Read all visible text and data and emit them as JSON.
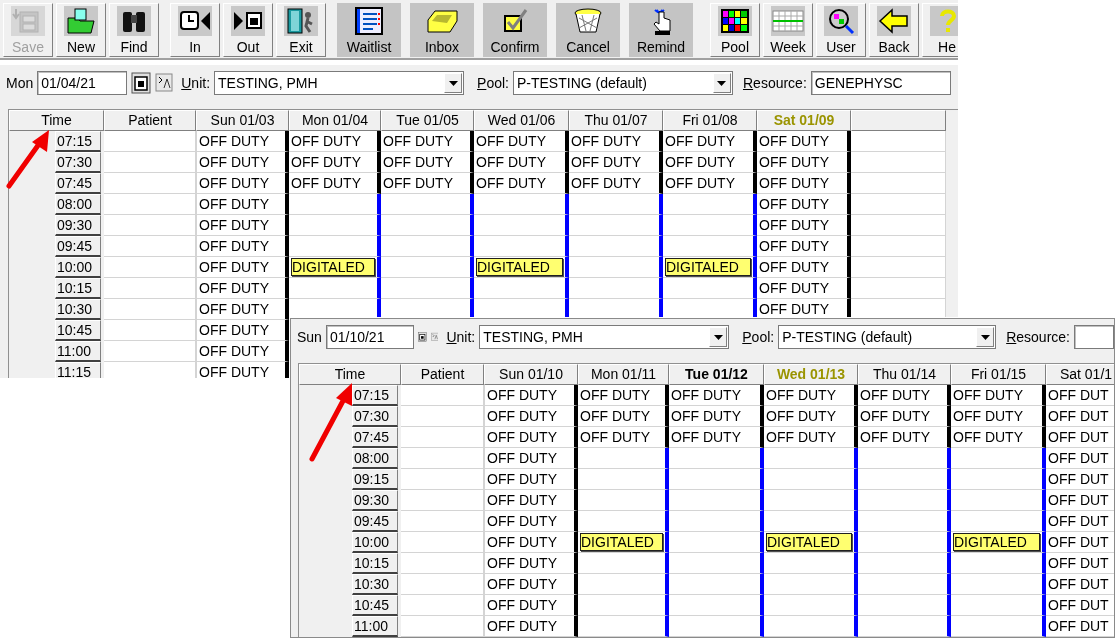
{
  "toolbar": {
    "groups": [
      {
        "kind": "raised",
        "buttons": [
          {
            "label": "Save",
            "disabled": true
          },
          {
            "label": "New",
            "disabled": false
          },
          {
            "label": "Find",
            "disabled": false
          }
        ]
      },
      {
        "kind": "raised",
        "buttons": [
          {
            "label": "In",
            "disabled": false
          },
          {
            "label": "Out",
            "disabled": false
          },
          {
            "label": "Exit",
            "disabled": false
          }
        ]
      },
      {
        "kind": "flat",
        "buttons": [
          {
            "label": "Waitlist",
            "disabled": false
          },
          {
            "label": "Inbox",
            "disabled": false
          },
          {
            "label": "Confirm",
            "disabled": false
          },
          {
            "label": "Cancel",
            "disabled": false
          },
          {
            "label": "Remind",
            "disabled": false
          }
        ]
      },
      {
        "kind": "raised",
        "buttons": [
          {
            "label": "Pool",
            "disabled": false
          },
          {
            "label": "Week",
            "disabled": false
          },
          {
            "label": "User",
            "disabled": false
          },
          {
            "label": "Back",
            "disabled": false
          },
          {
            "label": "He",
            "disabled": false
          }
        ]
      }
    ]
  },
  "windows": [
    {
      "day_label": "Mon",
      "date": "01/04/21",
      "unit_label": "Unit:",
      "unit": "TESTING, PMH",
      "pool_label": "Pool:",
      "pool": "P-TESTING (default)",
      "resource_label": "Resource:",
      "resource": "GENEPHYSC",
      "columns": [
        {
          "label": "Time",
          "kind": "plain"
        },
        {
          "label": "Patient",
          "kind": "plain"
        },
        {
          "label": "Sun 01/03",
          "kind": "plain"
        },
        {
          "label": "Mon 01/04",
          "kind": "plain"
        },
        {
          "label": "Tue 01/05",
          "kind": "plain"
        },
        {
          "label": "Wed 01/06",
          "kind": "plain"
        },
        {
          "label": "Thu 01/07",
          "kind": "plain"
        },
        {
          "label": "Fri 01/08",
          "kind": "plain"
        },
        {
          "label": "Sat 01/09",
          "kind": "highlighted"
        },
        {
          "kind": "blank"
        }
      ],
      "rows": [
        {
          "cells": [
            {
              "kind": "time",
              "text": "07:15"
            },
            {
              "kind": "empty"
            },
            {
              "kind": "duty",
              "text": "OFF DUTY"
            },
            {
              "kind": "duty",
              "text": "OFF DUTY"
            },
            {
              "kind": "duty",
              "text": "OFF DUTY"
            },
            {
              "kind": "duty",
              "text": "OFF DUTY"
            },
            {
              "kind": "duty",
              "text": "OFF DUTY"
            },
            {
              "kind": "duty",
              "text": "OFF DUTY"
            },
            {
              "kind": "duty",
              "text": "OFF DUTY"
            },
            {
              "kind": "empty"
            }
          ]
        },
        {
          "cells": [
            {
              "kind": "time",
              "text": "07:30"
            },
            {
              "kind": "empty"
            },
            {
              "kind": "duty",
              "text": "OFF DUTY"
            },
            {
              "kind": "duty",
              "text": "OFF DUTY"
            },
            {
              "kind": "duty",
              "text": "OFF DUTY"
            },
            {
              "kind": "duty",
              "text": "OFF DUTY"
            },
            {
              "kind": "duty",
              "text": "OFF DUTY"
            },
            {
              "kind": "duty",
              "text": "OFF DUTY"
            },
            {
              "kind": "duty",
              "text": "OFF DUTY"
            },
            {
              "kind": "empty"
            }
          ]
        },
        {
          "cells": [
            {
              "kind": "time",
              "text": "07:45"
            },
            {
              "kind": "empty"
            },
            {
              "kind": "duty",
              "text": "OFF DUTY"
            },
            {
              "kind": "duty",
              "text": "OFF DUTY"
            },
            {
              "kind": "duty",
              "text": "OFF DUTY"
            },
            {
              "kind": "duty",
              "text": "OFF DUTY"
            },
            {
              "kind": "duty",
              "text": "OFF DUTY"
            },
            {
              "kind": "duty",
              "text": "OFF DUTY"
            },
            {
              "kind": "duty",
              "text": "OFF DUTY"
            },
            {
              "kind": "empty"
            }
          ]
        },
        {
          "cells": [
            {
              "kind": "time",
              "text": "08:00"
            },
            {
              "kind": "empty"
            },
            {
              "kind": "duty",
              "text": "OFF DUTY"
            },
            {
              "kind": "empty"
            },
            {
              "kind": "empty"
            },
            {
              "kind": "empty"
            },
            {
              "kind": "empty"
            },
            {
              "kind": "empty"
            },
            {
              "kind": "duty",
              "text": "OFF DUTY"
            },
            {
              "kind": "empty"
            }
          ]
        },
        {
          "cells": [
            {
              "kind": "time",
              "text": "09:30"
            },
            {
              "kind": "empty"
            },
            {
              "kind": "duty",
              "text": "OFF DUTY"
            },
            {
              "kind": "empty"
            },
            {
              "kind": "empty"
            },
            {
              "kind": "empty"
            },
            {
              "kind": "empty"
            },
            {
              "kind": "empty"
            },
            {
              "kind": "duty",
              "text": "OFF DUTY"
            },
            {
              "kind": "empty"
            }
          ]
        },
        {
          "cells": [
            {
              "kind": "time",
              "text": "09:45"
            },
            {
              "kind": "empty"
            },
            {
              "kind": "duty",
              "text": "OFF DUTY"
            },
            {
              "kind": "empty"
            },
            {
              "kind": "empty"
            },
            {
              "kind": "empty"
            },
            {
              "kind": "empty"
            },
            {
              "kind": "empty"
            },
            {
              "kind": "duty",
              "text": "OFF DUTY"
            },
            {
              "kind": "empty"
            }
          ]
        },
        {
          "cells": [
            {
              "kind": "time",
              "text": "10:00"
            },
            {
              "kind": "empty"
            },
            {
              "kind": "duty",
              "text": "OFF DUTY"
            },
            {
              "kind": "appointment",
              "text": "DIGITALED"
            },
            {
              "kind": "empty"
            },
            {
              "kind": "appointment",
              "text": "DIGITALED"
            },
            {
              "kind": "empty"
            },
            {
              "kind": "appointment",
              "text": "DIGITALED"
            },
            {
              "kind": "duty",
              "text": "OFF DUTY"
            },
            {
              "kind": "empty"
            }
          ]
        },
        {
          "cells": [
            {
              "kind": "time",
              "text": "10:15"
            },
            {
              "kind": "empty"
            },
            {
              "kind": "duty",
              "text": "OFF DUTY"
            },
            {
              "kind": "empty"
            },
            {
              "kind": "empty"
            },
            {
              "kind": "empty"
            },
            {
              "kind": "empty"
            },
            {
              "kind": "empty"
            },
            {
              "kind": "duty",
              "text": "OFF DUTY"
            },
            {
              "kind": "empty"
            }
          ]
        },
        {
          "cells": [
            {
              "kind": "time",
              "text": "10:30"
            },
            {
              "kind": "empty"
            },
            {
              "kind": "duty",
              "text": "OFF DUTY"
            },
            {
              "kind": "empty"
            },
            {
              "kind": "empty"
            },
            {
              "kind": "empty"
            },
            {
              "kind": "empty"
            },
            {
              "kind": "empty"
            },
            {
              "kind": "duty",
              "text": "OFF DUTY"
            },
            {
              "kind": "empty"
            }
          ]
        },
        {
          "cells": [
            {
              "kind": "time",
              "text": "10:45"
            },
            {
              "kind": "empty"
            },
            {
              "kind": "duty",
              "text": "OFF DUTY"
            }
          ]
        },
        {
          "cells": [
            {
              "kind": "time",
              "text": "11:00"
            },
            {
              "kind": "empty"
            },
            {
              "kind": "duty",
              "text": "OFF DUTY"
            }
          ]
        },
        {
          "cells": [
            {
              "kind": "time",
              "text": "11:15"
            },
            {
              "kind": "empty"
            },
            {
              "kind": "duty",
              "text": "OFF DUTY"
            }
          ]
        }
      ]
    },
    {
      "day_label": "Sun",
      "date": "01/10/21",
      "unit_label": "Unit:",
      "unit": "TESTING, PMH",
      "pool_label": "Pool:",
      "pool": "P-TESTING (default)",
      "resource_label": "Resource:",
      "columns": [
        {
          "label": "Time",
          "kind": "plain"
        },
        {
          "label": "Patient",
          "kind": "plain"
        },
        {
          "label": "Sun 01/10",
          "kind": "plain"
        },
        {
          "label": "Mon 01/11",
          "kind": "plain"
        },
        {
          "label": "Tue 01/12",
          "kind": "current"
        },
        {
          "label": "Wed 01/13",
          "kind": "highlighted"
        },
        {
          "label": "Thu 01/14",
          "kind": "plain"
        },
        {
          "label": "Fri 01/15",
          "kind": "plain"
        },
        {
          "label": "Sat 01/1",
          "kind": "plain"
        }
      ],
      "rows": [
        {
          "cells": [
            {
              "kind": "time",
              "text": "07:15"
            },
            {
              "kind": "empty"
            },
            {
              "kind": "duty",
              "text": "OFF DUTY"
            },
            {
              "kind": "duty",
              "text": "OFF DUTY"
            },
            {
              "kind": "duty",
              "text": "OFF DUTY"
            },
            {
              "kind": "duty",
              "text": "OFF DUTY"
            },
            {
              "kind": "duty",
              "text": "OFF DUTY"
            },
            {
              "kind": "duty",
              "text": "OFF DUTY"
            },
            {
              "kind": "duty",
              "text": "OFF DUT"
            }
          ]
        },
        {
          "cells": [
            {
              "kind": "time",
              "text": "07:30"
            },
            {
              "kind": "empty"
            },
            {
              "kind": "duty",
              "text": "OFF DUTY"
            },
            {
              "kind": "duty",
              "text": "OFF DUTY"
            },
            {
              "kind": "duty",
              "text": "OFF DUTY"
            },
            {
              "kind": "duty",
              "text": "OFF DUTY"
            },
            {
              "kind": "duty",
              "text": "OFF DUTY"
            },
            {
              "kind": "duty",
              "text": "OFF DUTY"
            },
            {
              "kind": "duty",
              "text": "OFF DUT"
            }
          ]
        },
        {
          "cells": [
            {
              "kind": "time",
              "text": "07:45"
            },
            {
              "kind": "empty"
            },
            {
              "kind": "duty",
              "text": "OFF DUTY"
            },
            {
              "kind": "duty",
              "text": "OFF DUTY"
            },
            {
              "kind": "duty",
              "text": "OFF DUTY"
            },
            {
              "kind": "duty",
              "text": "OFF DUTY"
            },
            {
              "kind": "duty",
              "text": "OFF DUTY"
            },
            {
              "kind": "duty",
              "text": "OFF DUTY"
            },
            {
              "kind": "duty",
              "text": "OFF DUT"
            }
          ]
        },
        {
          "cells": [
            {
              "kind": "time",
              "text": "08:00"
            },
            {
              "kind": "empty"
            },
            {
              "kind": "duty",
              "text": "OFF DUTY"
            },
            {
              "kind": "empty"
            },
            {
              "kind": "empty"
            },
            {
              "kind": "empty"
            },
            {
              "kind": "empty"
            },
            {
              "kind": "empty"
            },
            {
              "kind": "duty",
              "text": "OFF DUT"
            }
          ]
        },
        {
          "cells": [
            {
              "kind": "time",
              "text": "09:15"
            },
            {
              "kind": "empty"
            },
            {
              "kind": "duty",
              "text": "OFF DUTY"
            },
            {
              "kind": "empty"
            },
            {
              "kind": "empty"
            },
            {
              "kind": "empty"
            },
            {
              "kind": "empty"
            },
            {
              "kind": "empty"
            },
            {
              "kind": "duty",
              "text": "OFF DUT"
            }
          ]
        },
        {
          "cells": [
            {
              "kind": "time",
              "text": "09:30"
            },
            {
              "kind": "empty"
            },
            {
              "kind": "duty",
              "text": "OFF DUTY"
            },
            {
              "kind": "empty"
            },
            {
              "kind": "empty"
            },
            {
              "kind": "empty"
            },
            {
              "kind": "empty"
            },
            {
              "kind": "empty"
            },
            {
              "kind": "duty",
              "text": "OFF DUT"
            }
          ]
        },
        {
          "cells": [
            {
              "kind": "time",
              "text": "09:45"
            },
            {
              "kind": "empty"
            },
            {
              "kind": "duty",
              "text": "OFF DUTY"
            },
            {
              "kind": "empty"
            },
            {
              "kind": "empty"
            },
            {
              "kind": "empty"
            },
            {
              "kind": "empty"
            },
            {
              "kind": "empty"
            },
            {
              "kind": "duty",
              "text": "OFF DUT"
            }
          ]
        },
        {
          "cells": [
            {
              "kind": "time",
              "text": "10:00"
            },
            {
              "kind": "empty"
            },
            {
              "kind": "duty",
              "text": "OFF DUTY"
            },
            {
              "kind": "appointment",
              "text": "DIGITALED"
            },
            {
              "kind": "empty"
            },
            {
              "kind": "appointment",
              "text": "DIGITALED"
            },
            {
              "kind": "empty"
            },
            {
              "kind": "appointment",
              "text": "DIGITALED"
            },
            {
              "kind": "duty",
              "text": "OFF DUT"
            }
          ]
        },
        {
          "cells": [
            {
              "kind": "time",
              "text": "10:15"
            },
            {
              "kind": "empty"
            },
            {
              "kind": "duty",
              "text": "OFF DUTY"
            },
            {
              "kind": "empty"
            },
            {
              "kind": "empty"
            },
            {
              "kind": "empty"
            },
            {
              "kind": "empty"
            },
            {
              "kind": "empty"
            },
            {
              "kind": "duty",
              "text": "OFF DUT"
            }
          ]
        },
        {
          "cells": [
            {
              "kind": "time",
              "text": "10:30"
            },
            {
              "kind": "empty"
            },
            {
              "kind": "duty",
              "text": "OFF DUTY"
            },
            {
              "kind": "empty"
            },
            {
              "kind": "empty"
            },
            {
              "kind": "empty"
            },
            {
              "kind": "empty"
            },
            {
              "kind": "empty"
            },
            {
              "kind": "duty",
              "text": "OFF DUT"
            }
          ]
        },
        {
          "cells": [
            {
              "kind": "time",
              "text": "10:45"
            },
            {
              "kind": "empty"
            },
            {
              "kind": "duty",
              "text": "OFF DUTY"
            },
            {
              "kind": "empty"
            },
            {
              "kind": "empty"
            },
            {
              "kind": "empty"
            },
            {
              "kind": "empty"
            },
            {
              "kind": "empty"
            },
            {
              "kind": "duty",
              "text": "OFF DUT"
            }
          ]
        },
        {
          "cells": [
            {
              "kind": "time",
              "text": "11:00"
            },
            {
              "kind": "empty"
            },
            {
              "kind": "duty",
              "text": "OFF DUTY"
            },
            {
              "kind": "empty"
            },
            {
              "kind": "empty"
            },
            {
              "kind": "empty"
            },
            {
              "kind": "empty"
            },
            {
              "kind": "empty"
            },
            {
              "kind": "duty",
              "text": "OFF DUT"
            }
          ]
        }
      ]
    }
  ]
}
